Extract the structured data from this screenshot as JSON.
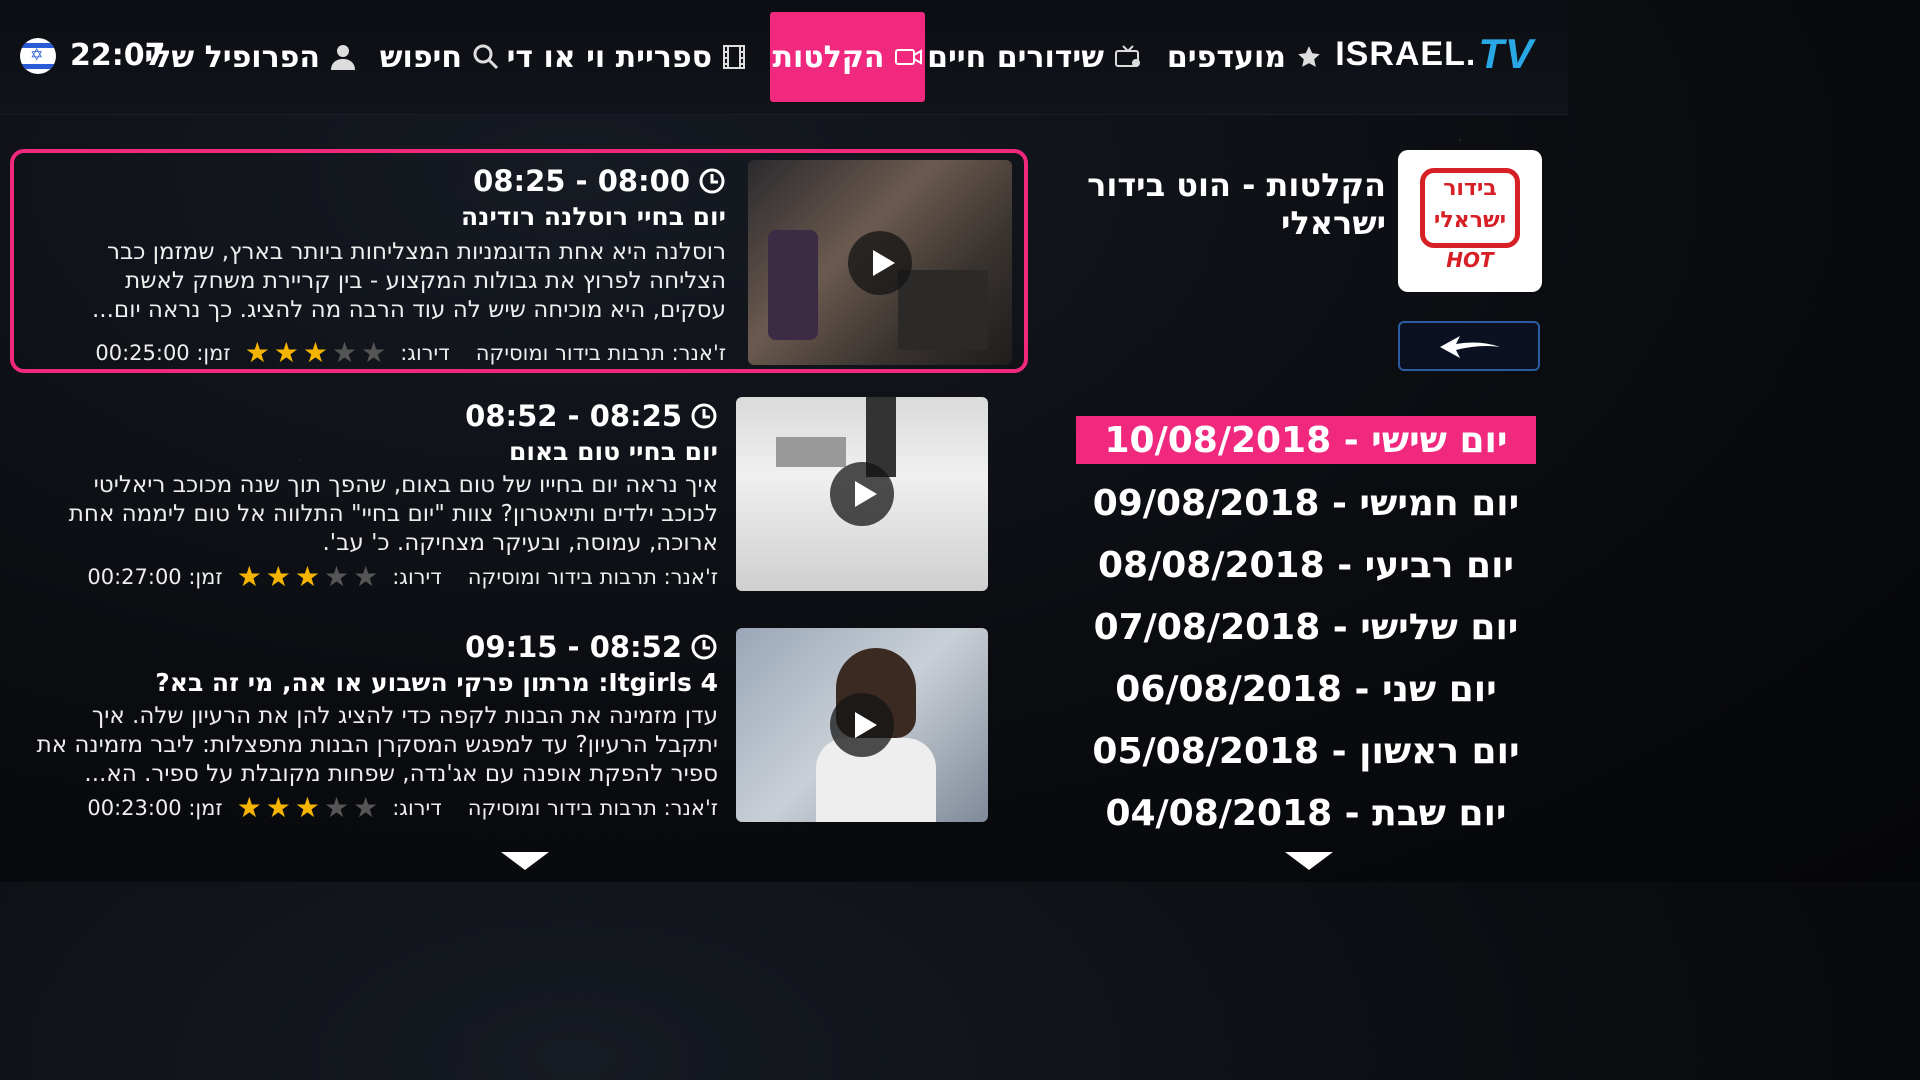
{
  "header": {
    "logo_text": "ISRAEL.",
    "logo_tv": "TV",
    "nav": {
      "favorites": "מועדפים",
      "live": "שידורים חיים",
      "recordings": "הקלטות",
      "vod": "ספריית וי או די",
      "search": "חיפוש",
      "profile": "הפרופיל שלי"
    },
    "clock": "22:07",
    "accent_color": "#f0297f"
  },
  "channel": {
    "title": "הקלטות - הוט בידור ישראלי",
    "logo_line1": "בידור",
    "logo_line2": "ישראלי",
    "logo_brand": "HOT"
  },
  "dates": [
    "יום שישי - 10/08/2018",
    "יום חמישי - 09/08/2018",
    "יום רביעי - 08/08/2018",
    "יום שלישי - 07/08/2018",
    "יום שני - 06/08/2018",
    "יום ראשון - 05/08/2018",
    "יום שבת - 04/08/2018"
  ],
  "programs": [
    {
      "time": "08:00 - 08:25",
      "title": "יום בחיי רוסלנה רודינה",
      "desc": "רוסלנה היא אחת הדוגמניות המצליחות ביותר בארץ, שמזמן כבר הצליחה לפרוץ את גבולות המקצוע - בין קריירת משחק לאשת עסקים, היא מוכיחה שיש לה עוד הרבה מה להציג. כך נראה יום...",
      "genre": "ז'אנר: תרבות בידור ומוסיקה",
      "rating_label": "דירוג:",
      "rating": 3,
      "duration": "זמן: 00:25:00"
    },
    {
      "time": "08:25 - 08:52",
      "title": "יום בחיי טום באום",
      "desc": "איך נראה יום בחייו של טום באום, שהפך תוך שנה מכוכב ריאליטי לכוכב ילדים ותיאטרון? צוות \"יום בחיי\" התלווה אל טום ליממה אחת ארוכה, עמוסה, ובעיקר מצחיקה. כ' עב'.",
      "genre": "ז'אנר: תרבות בידור ומוסיקה",
      "rating_label": "דירוג:",
      "rating": 3,
      "duration": "זמן: 00:27:00"
    },
    {
      "time": "08:52 - 09:15",
      "title": "Itgirls 4: מרתון פרקי השבוע או אה, מי זה בא?",
      "desc": "עדן מזמינה את הבנות לקפה כדי להציג להן את הרעיון שלה. איך יתקבל הרעיון? עד למפגש המסקרן הבנות מתפצלות: ליבר מזמינה את ספיר להפקת אופנה עם אג'נדה, שפחות מקובלת על ספיר. הא...",
      "genre": "ז'אנר: תרבות בידור ומוסיקה",
      "rating_label": "דירוג:",
      "rating": 3,
      "duration": "זמן: 00:23:00"
    }
  ]
}
